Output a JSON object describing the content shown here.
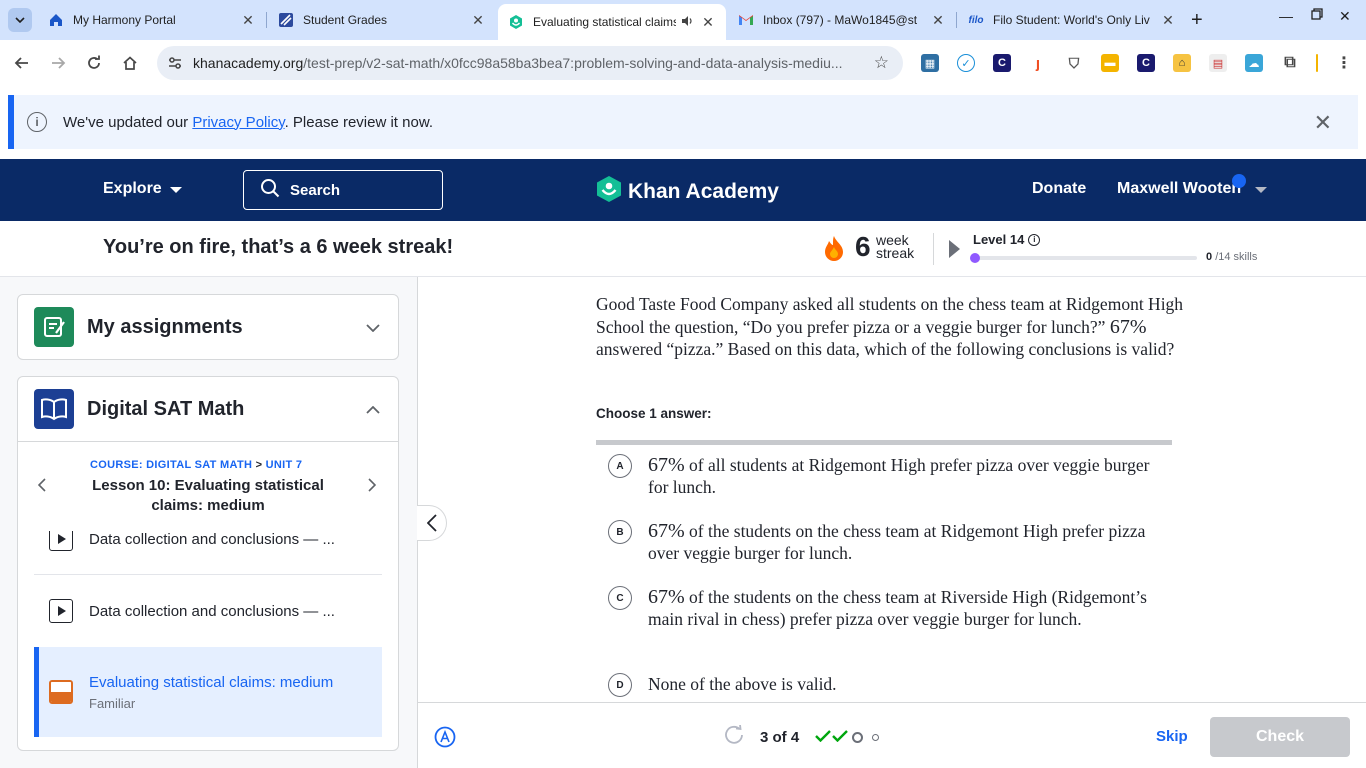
{
  "browser": {
    "tabs": [
      {
        "title": "My Harmony Portal",
        "icon": "harmony-house-icon"
      },
      {
        "title": "Student Grades",
        "icon": "grades-icon"
      },
      {
        "title": "Evaluating statistical claims",
        "icon": "khan-academy-icon",
        "active": true
      },
      {
        "title": "Inbox (797) - MaWo1845@st",
        "icon": "gmail-icon"
      },
      {
        "title": "Filo Student: World's Only Liv",
        "icon": "filo-icon"
      }
    ],
    "url_host": "khanacademy.org",
    "url_path": "/test-prep/v2-sat-math/x0fcc98a58ba3bea7:problem-solving-and-data-analysis-mediu..."
  },
  "banner": {
    "prefix": "We've updated our ",
    "link": "Privacy Policy",
    "suffix": ". Please review it now."
  },
  "header": {
    "explore": "Explore",
    "search": "Search",
    "logo": "Khan Academy",
    "donate": "Donate",
    "user": "Maxwell Wooten"
  },
  "streak": {
    "message": "You’re on fire, that’s a 6 week streak!",
    "count": "6",
    "label_line1": "week",
    "label_line2": "streak",
    "level": "Level 14",
    "skills_done": "0",
    "skills_total": "/14 skills",
    "level_progress": 0
  },
  "sidebar": {
    "assignments": "My assignments",
    "course": "Digital SAT Math",
    "crumb_course": "COURSE: DIGITAL SAT MATH",
    "crumb_sep": ">",
    "crumb_unit": "UNIT 7",
    "lesson_title": "Lesson 10: Evaluating statistical claims: medium",
    "items": [
      {
        "label": "Data collection and conclusions — ..."
      },
      {
        "label": "Data collection and conclusions — ..."
      }
    ],
    "active_item": {
      "label": "Evaluating statistical claims: medium",
      "status": "Familiar"
    }
  },
  "question": {
    "p1": "Good Taste Food Company asked all students on the chess team at Ridgemont High School the question, “Do you prefer pizza or a veggie burger for lunch?” ",
    "math": "67%",
    "p2": " answered “pizza.” Based on this data, which of the following conclusions is valid?",
    "prompt": "Choose 1 answer:",
    "choices": [
      {
        "letter": "A",
        "math": "67%",
        "text": " of all students at Ridgemont High prefer pizza over veggie burger for lunch."
      },
      {
        "letter": "B",
        "math": "67%",
        "text": " of the students on the chess team at Ridgemont High prefer pizza over veggie burger for lunch."
      },
      {
        "letter": "C",
        "math": "67%",
        "text": " of the students on the chess team at Riverside High (Ridgemont’s main rival in chess) prefer pizza over veggie burger for lunch."
      },
      {
        "letter": "D",
        "math": "",
        "text": "None of the above is valid."
      }
    ]
  },
  "footer": {
    "counter": "3 of 4",
    "skip": "Skip",
    "check": "Check"
  },
  "colors": {
    "ka_navy": "#0a2a66",
    "ka_blue": "#1865f2",
    "correct_green": "#00a60e",
    "streak_orange": "#ff6a00"
  }
}
